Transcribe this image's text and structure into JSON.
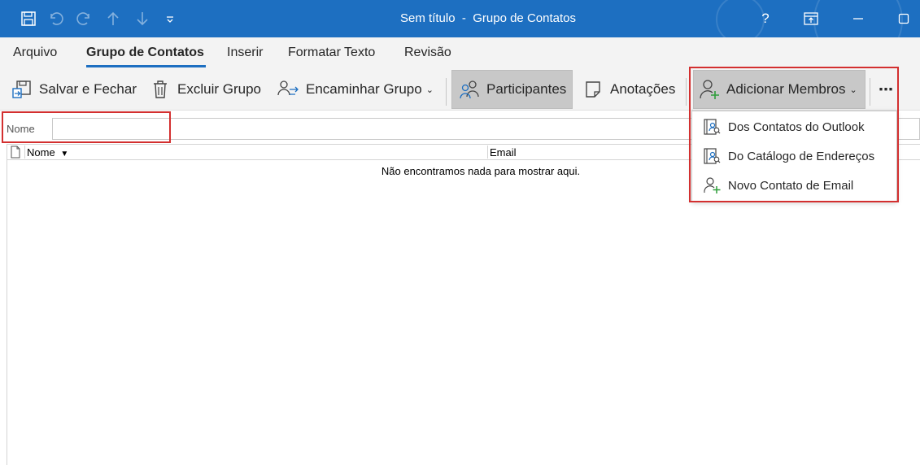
{
  "window": {
    "title_doc": "Sem título",
    "title_sep": "-",
    "title_app": "Grupo de Contatos",
    "help": "?",
    "accent": "#1d6fc1"
  },
  "quick_access": [
    {
      "name": "save-icon"
    },
    {
      "name": "undo-icon"
    },
    {
      "name": "redo-icon"
    },
    {
      "name": "arrow-up-icon"
    },
    {
      "name": "arrow-down-icon"
    },
    {
      "name": "customize-qat-icon"
    }
  ],
  "tabs": [
    {
      "label": "Arquivo"
    },
    {
      "label": "Grupo de Contatos",
      "active": true
    },
    {
      "label": "Inserir"
    },
    {
      "label": "Formatar Texto"
    },
    {
      "label": "Revisão"
    }
  ],
  "ribbon": {
    "save_close": "Salvar e Fechar",
    "delete_group": "Excluir Grupo",
    "forward_group": "Encaminhar Grupo",
    "participants": "Participantes",
    "notes": "Anotações",
    "add_members": "Adicionar Membros",
    "more": "⋯"
  },
  "form": {
    "name_label": "Nome",
    "name_value": ""
  },
  "grid": {
    "col_name": "Nome",
    "col_email": "Email",
    "empty_message": "Não encontramos nada para mostrar aqui."
  },
  "add_members_menu": {
    "items": [
      {
        "label": "Dos Contatos do Outlook",
        "icon": "address-book-icon"
      },
      {
        "label": "Do Catálogo de Endereços",
        "icon": "address-book-icon"
      },
      {
        "label": "Novo Contato de Email",
        "icon": "add-person-icon"
      }
    ]
  },
  "highlight_color": "#d32f2f"
}
